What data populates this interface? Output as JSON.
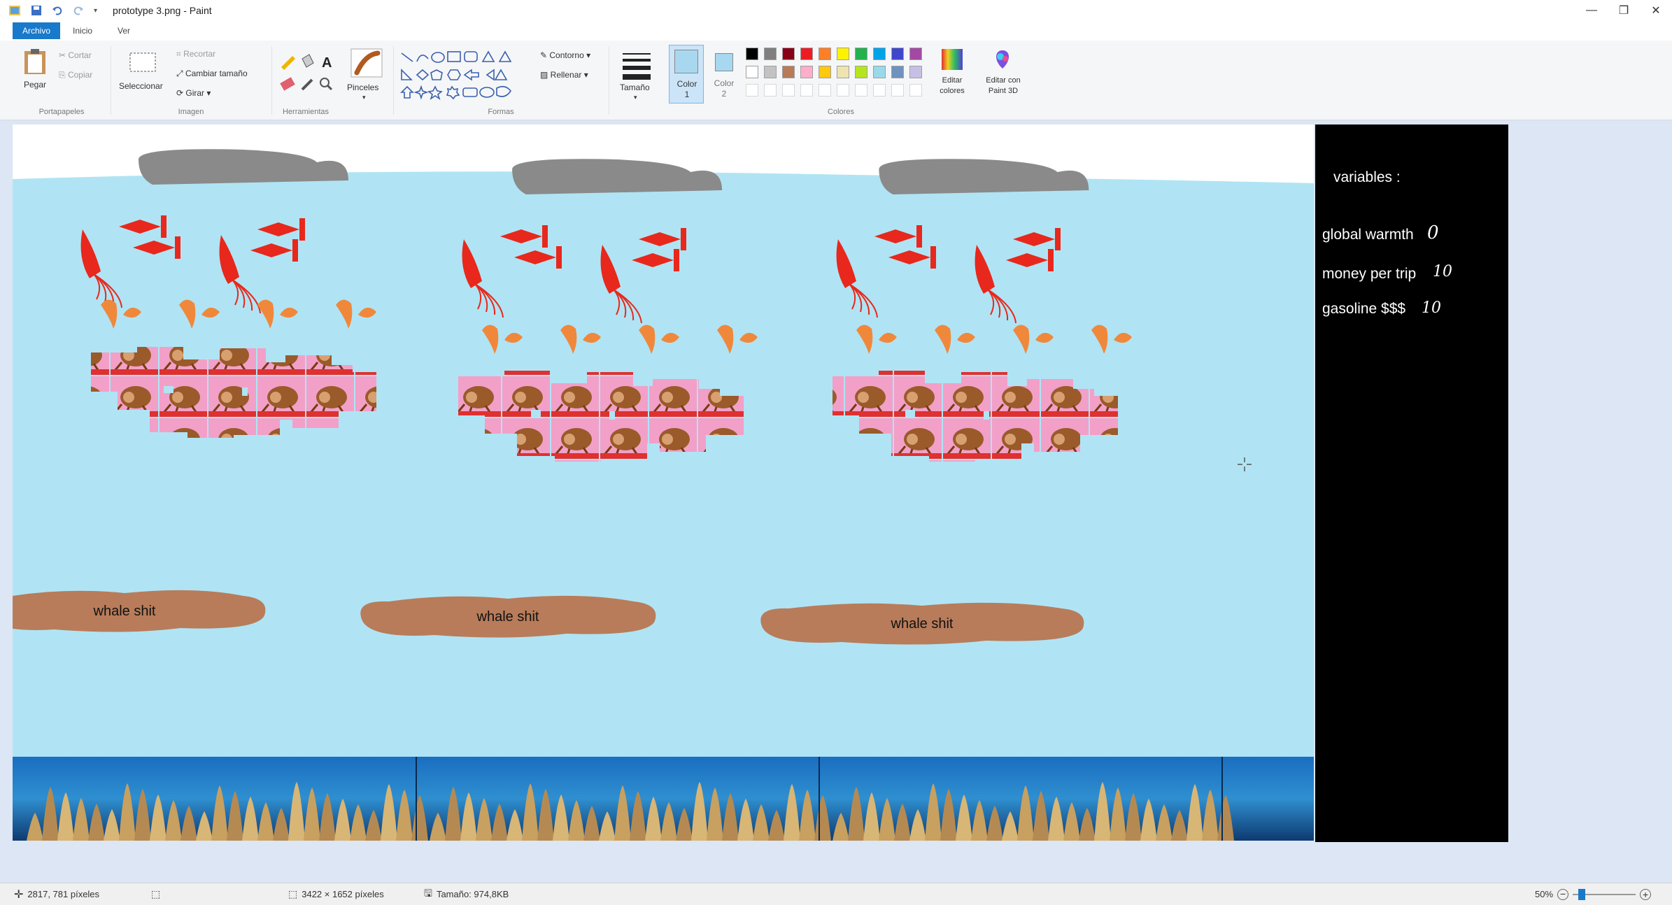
{
  "window": {
    "title": "prototype 3.png - Paint",
    "minimize_icon": "minimize-icon",
    "maximize_icon": "restore-icon",
    "close_icon": "close-icon"
  },
  "menu_tabs": [
    "Archivo",
    "Inicio",
    "Ver"
  ],
  "ribbon": {
    "portapapeles": {
      "label": "Portapapeles",
      "paste": "Pegar",
      "cut": "Cortar",
      "copy": "Copiar"
    },
    "imagen": {
      "label": "Imagen",
      "select": "Seleccionar",
      "crop": "Recortar",
      "resize": "Cambiar tamaño",
      "rotate": "Girar"
    },
    "herramientas": {
      "label": "Herramientas"
    },
    "pinceles": {
      "label": "Pinceles"
    },
    "formas": {
      "label": "Formas",
      "outline": "Contorno",
      "fill": "Rellenar"
    },
    "tamano": {
      "label": "Tamaño"
    },
    "color1": {
      "label": "Color 1",
      "value": "#a8d8f0"
    },
    "color2": {
      "label": "Color 2",
      "value": "#a8d8f0"
    },
    "colores": {
      "label": "Colores"
    },
    "edit_colors": "Editar colores",
    "edit_paint3d": "Editar con Paint 3D",
    "palette": [
      "#000000",
      "#7f7f7f",
      "#880015",
      "#ed1c24",
      "#ff7f27",
      "#fff200",
      "#22b14c",
      "#00a2e8",
      "#3f48cc",
      "#a349a4",
      "#ffffff",
      "#c3c3c3",
      "#b97a57",
      "#ffaec9",
      "#ffc90e",
      "#efe4b0",
      "#b5e61d",
      "#99d9ea",
      "#7092be",
      "#c8bfe7"
    ]
  },
  "canvas": {
    "water_color": "#b0e4f4",
    "whale_color": "#8a8a8a",
    "creature_color": "#e8281c",
    "shrimp_color": "#f0883c",
    "blob_color": "#b87c5a",
    "blob_labels": [
      "whale shit",
      "whale shit",
      "whale shit"
    ]
  },
  "variables_panel": {
    "title": "variables :",
    "items": [
      {
        "label": "global warmth",
        "value": "0"
      },
      {
        "label": "money per trip",
        "value": "10"
      },
      {
        "label": "gasoline $$$",
        "value": "10"
      }
    ]
  },
  "status": {
    "cursor": "2817, 781 píxeles",
    "size": "3422 × 1652 píxeles",
    "filesize": "Tamaño: 974,8KB",
    "zoom": "50%"
  }
}
